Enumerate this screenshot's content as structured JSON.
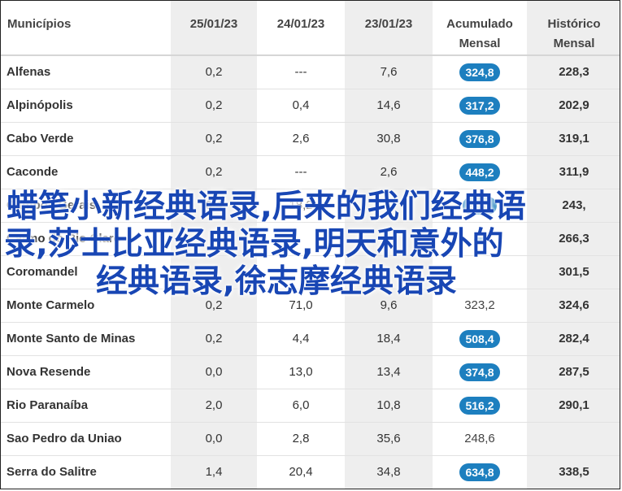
{
  "headers": [
    "Municípios",
    "25/01/23",
    "24/01/23",
    "23/01/23",
    "Acumulado\nMensal",
    "Histórico\nMensal"
  ],
  "rows": [
    {
      "name": "Alfenas",
      "d1": "0,2",
      "d2": "---",
      "d3": "7,6",
      "acc": "324,8",
      "badge": true,
      "hist": "228,3"
    },
    {
      "name": "Alpinópolis",
      "d1": "0,2",
      "d2": "0,4",
      "d3": "14,6",
      "acc": "317,2",
      "badge": true,
      "hist": "202,9"
    },
    {
      "name": "Cabo Verde",
      "d1": "0,2",
      "d2": "2,6",
      "d3": "30,8",
      "acc": "376,8",
      "badge": true,
      "hist": "319,1"
    },
    {
      "name": "Caconde",
      "d1": "0,2",
      "d2": "---",
      "d3": "2,6",
      "acc": "448,2",
      "badge": true,
      "hist": "311,9"
    },
    {
      "name": "Campos Gerais",
      "d1": "0,4",
      "d2": "18,2",
      "d3": "",
      "acc": "436,",
      "badge": true,
      "hist": "243,"
    },
    {
      "name": "Carmo do Rio Claro",
      "d1": "",
      "d2": "",
      "d3": "",
      "acc": "",
      "badge": true,
      "hist": "266,3"
    },
    {
      "name": "Coromandel",
      "d1": "",
      "d2": "",
      "d3": "",
      "acc": "",
      "badge": false,
      "hist": "301,5"
    },
    {
      "name": "Monte Carmelo",
      "d1": "0,2",
      "d2": "71,0",
      "d3": "9,6",
      "acc": "323,2",
      "badge": false,
      "hist": "324,6"
    },
    {
      "name": "Monte Santo de Minas",
      "d1": "0,2",
      "d2": "4,4",
      "d3": "18,4",
      "acc": "508,4",
      "badge": true,
      "hist": "282,4"
    },
    {
      "name": "Nova Resende",
      "d1": "0,0",
      "d2": "13,0",
      "d3": "13,4",
      "acc": "374,8",
      "badge": true,
      "hist": "287,5"
    },
    {
      "name": "Rio Paranaíba",
      "d1": "2,0",
      "d2": "6,0",
      "d3": "10,8",
      "acc": "516,2",
      "badge": true,
      "hist": "290,1"
    },
    {
      "name": "Sao Pedro da Uniao",
      "d1": "0,0",
      "d2": "2,8",
      "d3": "35,6",
      "acc": "248,6",
      "badge": false,
      "hist": ""
    },
    {
      "name": "Serra do Salitre",
      "d1": "1,4",
      "d2": "20,4",
      "d3": "34,8",
      "acc": "634,8",
      "badge": true,
      "hist": "338,5"
    }
  ],
  "overlay_lines": [
    "蜡笔小新经典语录,后来的我们经典语",
    "录,莎士比亚经典语录,明天和意外的",
    "经典语录,徐志摩经典语录"
  ],
  "colors": {
    "badge": "#1d7fbf",
    "overlay_text": "#1846b4",
    "shaded_column": "#eeeeee"
  }
}
